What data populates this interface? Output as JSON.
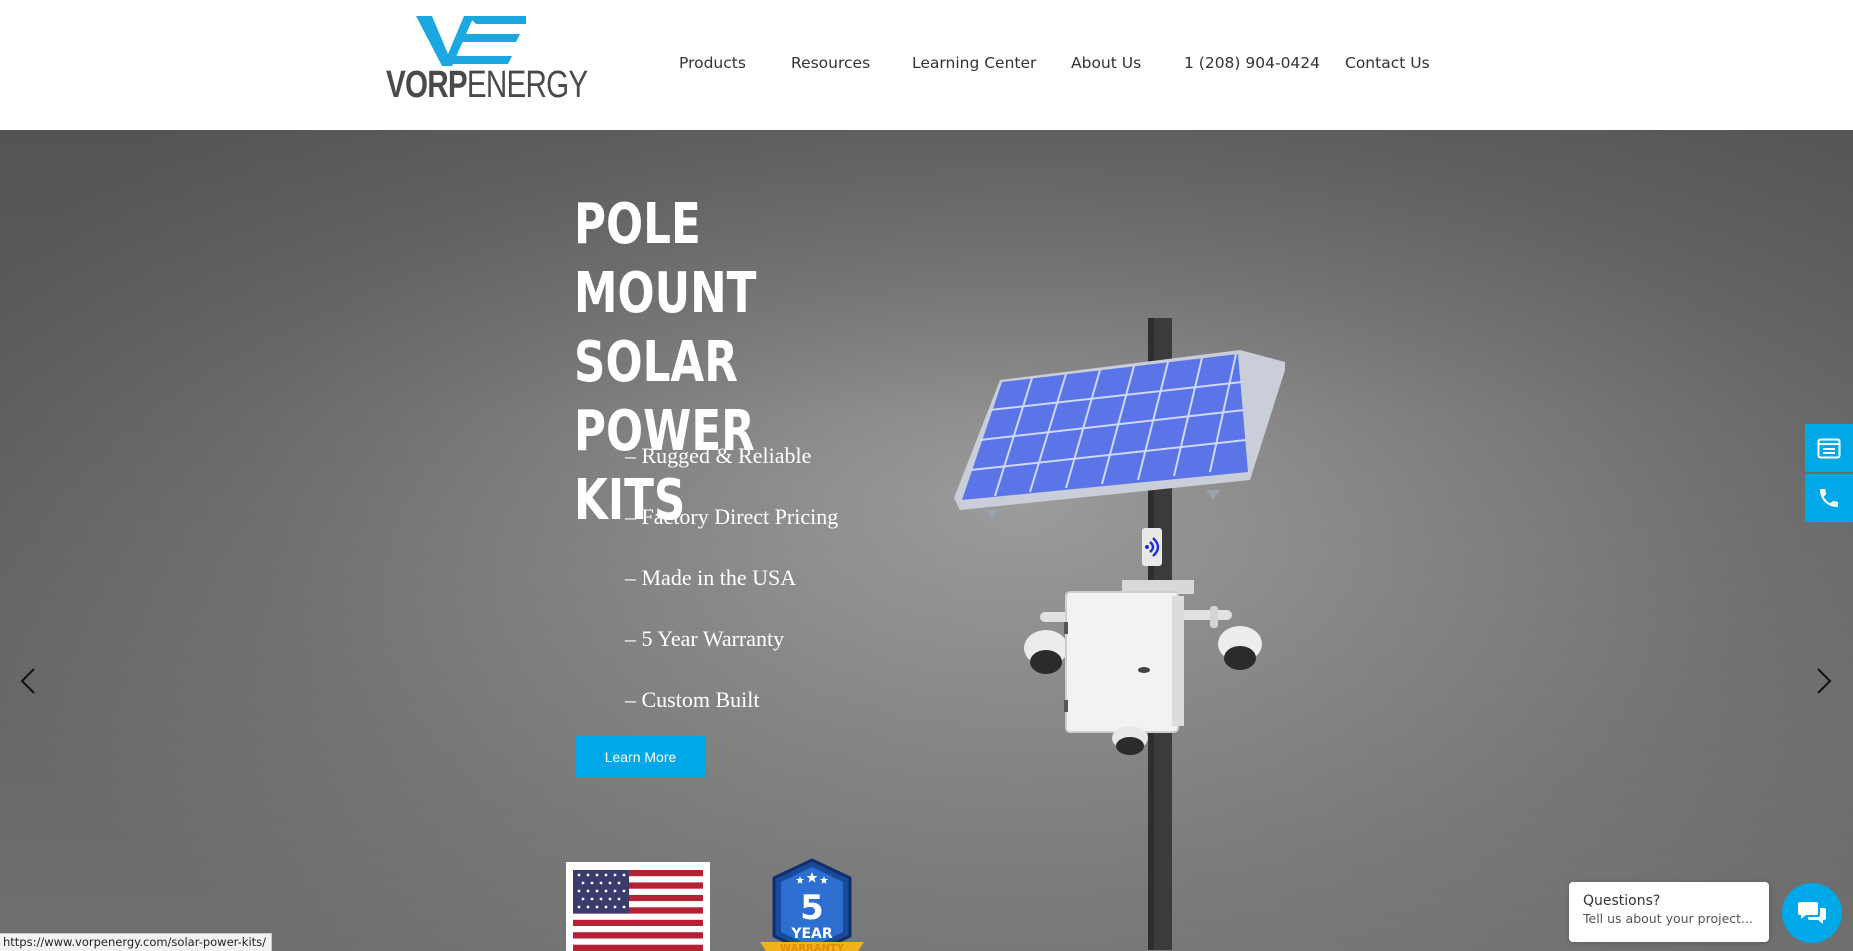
{
  "brand": {
    "logo_mark": "VE",
    "name_bold": "VORP",
    "name_light": "ENERGY",
    "accent_color": "#00a8e8"
  },
  "nav": {
    "items": [
      {
        "label": "Products"
      },
      {
        "label": "Resources"
      },
      {
        "label": "Learning Center"
      },
      {
        "label": "About Us"
      },
      {
        "label": "1 (208) 904-0424"
      },
      {
        "label": "Contact Us"
      }
    ]
  },
  "hero": {
    "title_lines": [
      "POLE MOUNT",
      "SOLAR POWER",
      "KITS"
    ],
    "features": [
      "– Rugged & Reliable",
      "– Factory Direct Pricing",
      "– Made in the USA",
      "– 5 Year Warranty",
      "– Custom Built"
    ],
    "cta_label": "Learn More",
    "prev_icon": "chevron-left-icon",
    "next_icon": "chevron-right-icon"
  },
  "badges": {
    "warranty_number": "5",
    "warranty_unit": "YEAR",
    "warranty_ribbon": "WARRANTY"
  },
  "side_buttons": {
    "top_icon": "quote-form-icon",
    "bottom_icon": "phone-icon"
  },
  "chat": {
    "title": "Questions?",
    "subtitle": "Tell us about your project...",
    "icon": "chat-icon"
  },
  "status_bar": {
    "url": "https://www.vorpenergy.com/solar-power-kits/"
  }
}
